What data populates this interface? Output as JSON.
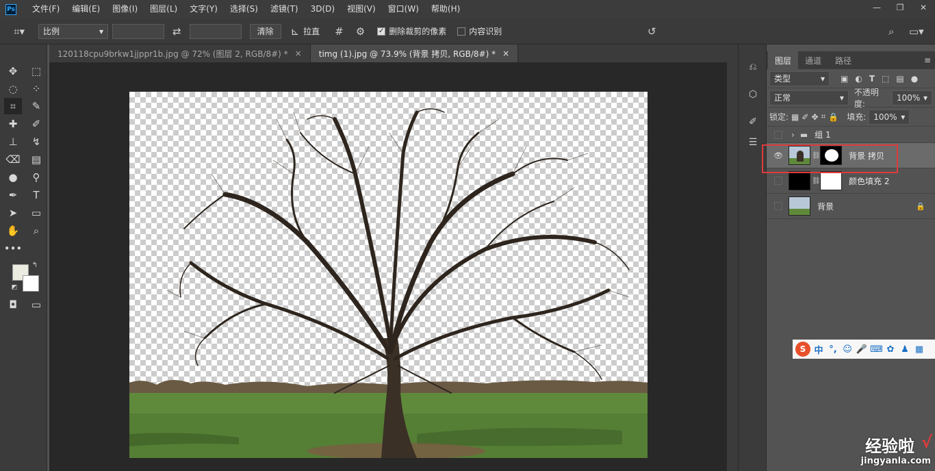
{
  "app": {
    "logo": "Ps"
  },
  "menu": [
    "文件(F)",
    "编辑(E)",
    "图像(I)",
    "图层(L)",
    "文字(Y)",
    "选择(S)",
    "滤镜(T)",
    "3D(D)",
    "视图(V)",
    "窗口(W)",
    "帮助(H)"
  ],
  "window_controls": {
    "minimize": "—",
    "restore": "❐",
    "close": "✕"
  },
  "options": {
    "ratio_select": "比例",
    "swap_icon": "⇄",
    "clear_label": "清除",
    "straighten_label": "拉直",
    "delete_cropped_label": "删除裁剪的像素",
    "delete_cropped_checked": true,
    "content_aware_label": "内容识别",
    "content_aware_checked": false
  },
  "tabs": [
    {
      "label": "120118cpu9brkw1jjppr1b.jpg @ 72% (图层 2, RGB/8#) *",
      "active": false,
      "close": "×"
    },
    {
      "label": "timg (1).jpg @ 73.9% (背景 拷贝, RGB/8#) *",
      "active": true,
      "close": "×"
    }
  ],
  "layers_panel": {
    "tabs": [
      "图层",
      "通道",
      "路径"
    ],
    "filter_kind": "类型",
    "blend_mode": "正常",
    "opacity_label": "不透明度:",
    "opacity_value": "100%",
    "lock_label": "锁定:",
    "fill_label": "填充:",
    "fill_value": "100%",
    "layers": [
      {
        "name": "组 1",
        "type": "group",
        "visible": false
      },
      {
        "name": "背景 拷贝",
        "type": "masked",
        "visible": true,
        "selected": true
      },
      {
        "name": "颜色填充 2",
        "type": "fill",
        "visible": false
      },
      {
        "name": "背景",
        "type": "image",
        "visible": false,
        "locked": true
      }
    ]
  },
  "ime_bar": {
    "label": "中"
  },
  "watermark": {
    "cn": "经验啦",
    "url": "jingyanla.com",
    "check": "√"
  },
  "colors": {
    "highlight": "#e03b3b",
    "ps_blue": "#31a8ff"
  }
}
